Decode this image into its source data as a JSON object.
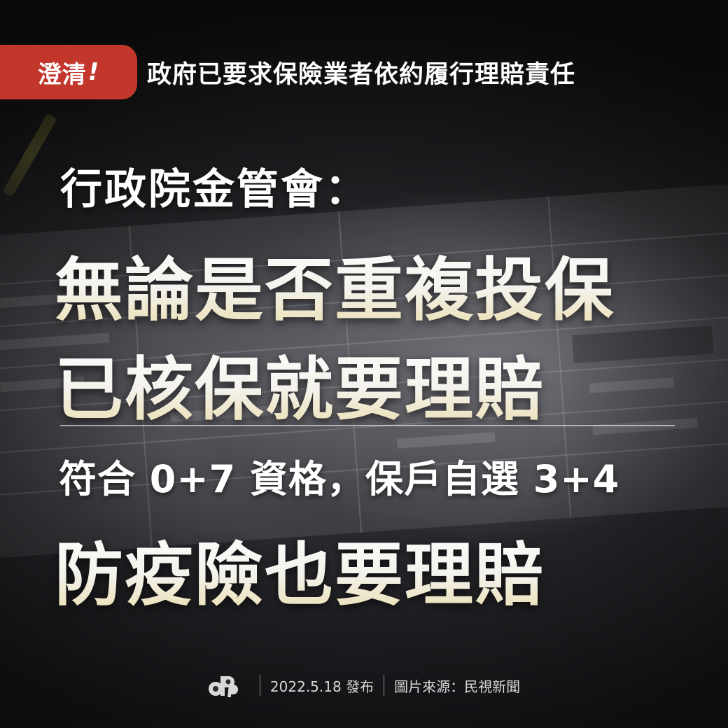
{
  "header": {
    "tag_text": "澄清",
    "tag_mark": "!",
    "headline": "政府已要求保險業者依約履行理賠責任"
  },
  "body": {
    "subhead": "行政院金管會：",
    "line1": "無論是否重複投保",
    "line2": "已核保就要理賠",
    "line3": "符合 0+7 資格，保戶自選 3+4",
    "line4": "防疫險也要理賠"
  },
  "footer": {
    "logo_icon": "dpp-logo-icon",
    "date": "2022.5.18 發布",
    "source": "圖片來源：民視新聞"
  },
  "colors": {
    "tag_red": "#c2362c",
    "text_white": "#ffffff",
    "gold_gradient_end": "#e9dcaa"
  }
}
